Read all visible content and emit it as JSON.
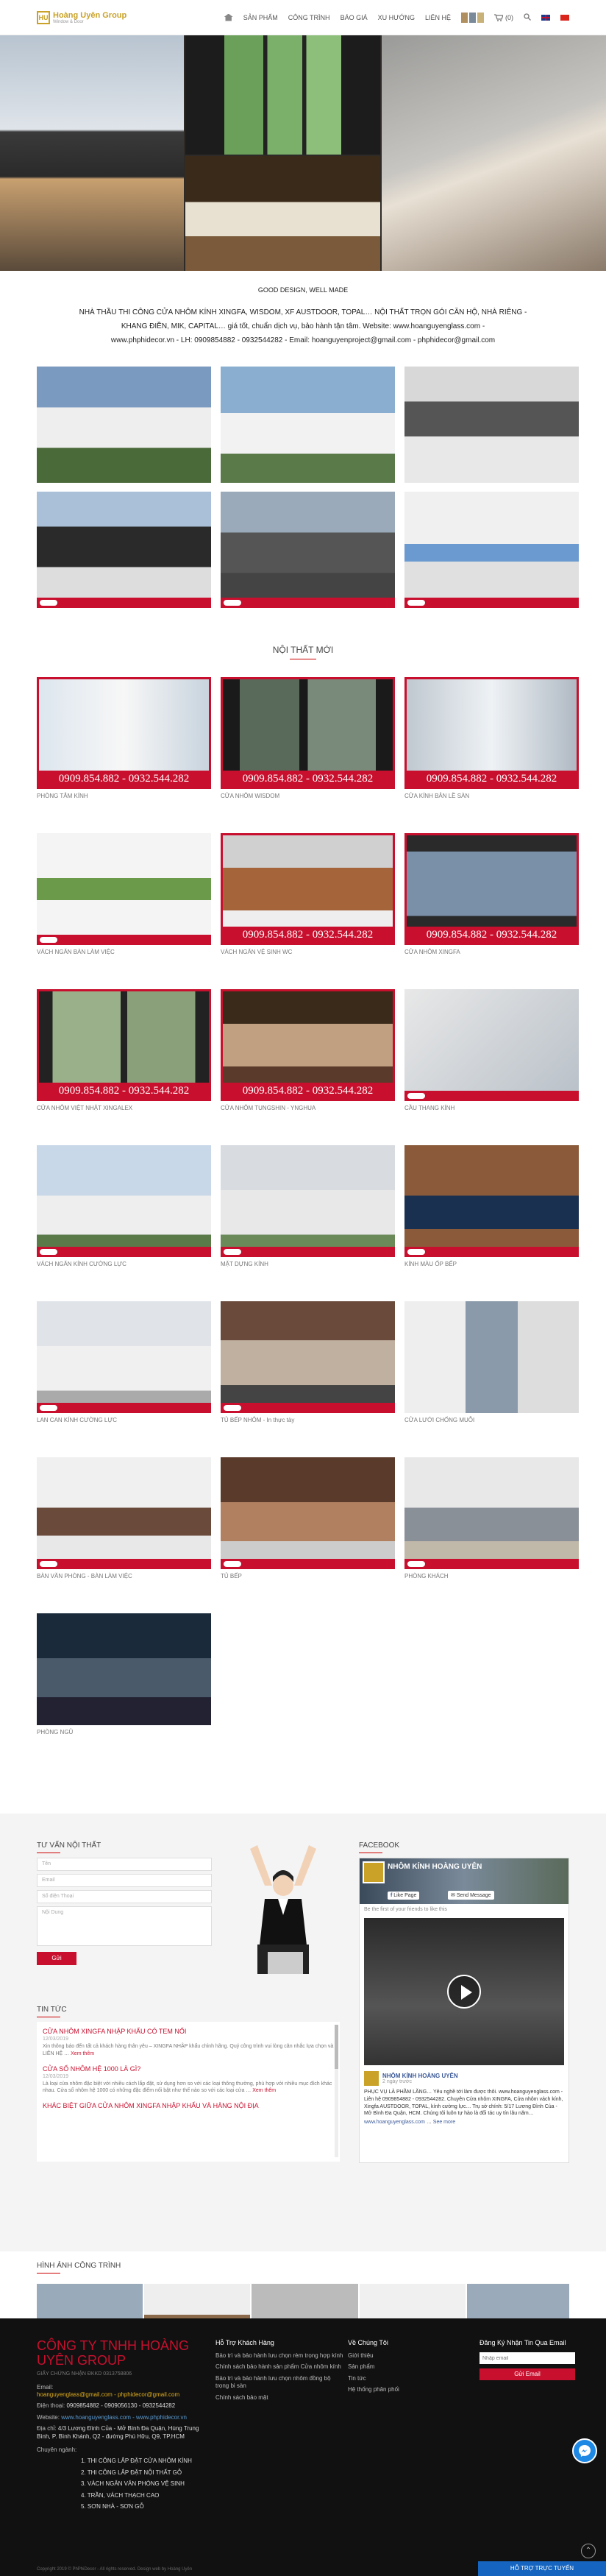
{
  "header": {
    "logo_mark": "HU",
    "logo_title": "Hoàng Uyên Group",
    "logo_sub": "Window & Door",
    "nav": [
      "SẢN PHẨM",
      "CÔNG TRÌNH",
      "BÁO GIÁ",
      "XU HƯỚNG",
      "LIÊN HỆ"
    ],
    "cart": "(0)"
  },
  "intro": {
    "slogan": "GOOD DESIGN, WELL MADE",
    "line1": "NHÀ THẦU THI CÔNG CỬA NHÔM KÍNH XINGFA, WISDOM, XF AUSTDOOR, TOPAL… NỘI THẤT TRỌN GÓI CĂN HỘ, NHÀ RIÊNG -",
    "line2": "KHANG ĐIỀN, MIK, CAPITAL… giá tốt, chuẩn dịch vụ, bảo hành tận tâm. Website: www.hoanguyenglass.com -",
    "line3": "www.phphidecor.vn - LH: 0909854882 - 0932544282 - Email: hoanguyenproject@gmail.com - phphidecor@gmail.com"
  },
  "products": {
    "title": "NỘI THẤT MỚI",
    "phone": "0909.854.882 - 0932.544.282",
    "items": [
      {
        "name": "PHÒNG TẮM KÍNH"
      },
      {
        "name": "CỬA NHÔM WISDOM"
      },
      {
        "name": "CỬA KÍNH BẢN LỀ SÀN"
      },
      {
        "name": "VÁCH NGĂN BÀN LÀM VIỆC"
      },
      {
        "name": "VÁCH NGĂN VỆ SINH WC"
      },
      {
        "name": "CỬA NHÔM XINGFA"
      },
      {
        "name": "CỬA NHÔM VIỆT NHẬT XINGALEX"
      },
      {
        "name": "CỬA NHÔM TUNGSHIN - YNGHUA"
      },
      {
        "name": "CẦU THANG KÍNH"
      },
      {
        "name": "VÁCH NGĂN KÍNH CƯỜNG LỰC"
      },
      {
        "name": "MẶT DỰNG KÍNH"
      },
      {
        "name": "KÍNH MÀU ỐP BẾP"
      },
      {
        "name": "LAN CAN KÍNH CƯỜNG LỰC"
      },
      {
        "name": "TỦ BẾP NHÔM - In thực tày"
      },
      {
        "name": "CỬA LƯỚI CHỐNG MUỖI"
      },
      {
        "name": "BÀN VĂN PHÒNG - BÀN LÀM VIỆC"
      },
      {
        "name": "TỦ BẾP"
      },
      {
        "name": "PHÒNG KHÁCH"
      },
      {
        "name": "PHÒNG NGỦ"
      }
    ]
  },
  "consult": {
    "title": "TƯ VẤN NỘI THẤT",
    "fields": [
      "Tên",
      "Email",
      "Số điện Thoại",
      "Nội Dung"
    ],
    "submit": "Gửi"
  },
  "news": {
    "title": "TIN TỨC",
    "items": [
      {
        "title": "CỬA NHÔM XINGFA NHẬP KHẨU CÓ TEM NỔI",
        "date": "12/03/2019",
        "excerpt": "Xin thông báo đến tất cả khách hàng thân yêu – XINGFA NHẬP khẩu chỉnh hãng. Quý công trình vui lòng cân nhắc lựa chọn và LIÊN HỆ …",
        "more": "Xem thêm"
      },
      {
        "title": "CỬA SỔ NHÔM HỆ 1000 LÀ GÌ?",
        "date": "12/03/2019",
        "excerpt": "Là loại cửa nhôm đặc biệt với nhiều cách lắp đặt, sử dụng hơn so với các loại thông thường, phù hợp với nhiều mục đích khác nhau. Cửa sổ nhôm hệ 1000 có những đặc điểm nổi bật như thế nào so với các loại cửa …",
        "more": "Xem thêm"
      },
      {
        "title": "KHÁC BIỆT GIỮA CỬA NHÔM XINGFA NHẬP KHẨU VÀ HÀNG NỘI ĐỊA",
        "date": "",
        "excerpt": "",
        "more": ""
      }
    ]
  },
  "facebook": {
    "title": "FACEBOOK",
    "page": "NHÔM KÍNH HOÀNG UYÊN",
    "like": "Like Page",
    "msg": "Send Message",
    "first": "Be the first of your friends to like this",
    "post_author": "NHÔM KÍNH HOÀNG UYÊN",
    "post_time": "2 ngày trước",
    "post_text": "PHỤC VỤ LÀ PHẦM LĂNG… Yêu nghề tới làm được thôi. www.hoanguyenglass.com - Liên hệ 0909854882 - 0932544282. Chuyên Cửa nhôm XINGFA, Cửa nhôm vách kính, Xingfa AUSTDOOR, TOPAL, kính cường lực… Trụ sở chính: 5/17 Lương Đình Của - Mở Bình Đa Quận, HCM. Chúng tôi luôn tự hào là đối tác uy tín lâu năm…",
    "post_link": "www.hoanguyenglass.com",
    "see_more": "See more"
  },
  "projects": {
    "title": "HÌNH ẢNH CÔNG TRÌNH"
  },
  "footer": {
    "company": "CÔNG TY TNHH HOÀNG UYÊN GROUP",
    "slogan": "GIẤY CHỨNG NHẬN ĐKKD 0313758806",
    "email_label": "Email:",
    "email": "hoanguyenglass@gmail.com - phphidecor@gmail.com",
    "phone_label": "Điện thoại:",
    "phone": "0909854882 - 0909056130 - 0932544282",
    "web_label": "Website:",
    "web": "www.hoanguyenglass.com - www.phphidecor.vn",
    "addr_label": "Địa chỉ:",
    "addr": "4/3 Lương Đình Của - Mở Bình Đa Quận, Hùng Trung Bình, P. Bình Khánh, Q2 - đường Phú Hữu, Q9, TP.HCM",
    "specialty_label": "Chuyên ngành:",
    "specialties": [
      "1. THI CÔNG LẮP ĐẶT CỬA NHÔM KÍNH",
      "2. THI CÔNG LẮP ĐẶT NỘI THẤT GỖ",
      "3. VÁCH NGĂN VĂN PHÒNG VỆ SINH",
      "4. TRẦN, VÁCH THẠCH CAO",
      "5. SƠN NHÀ - SƠN GỖ"
    ],
    "col2_title": "Hỗ Trợ Khách Hàng",
    "col2": [
      "Bảo trì và bảo hành lưu chọn rèm trọng hợp kính",
      "Chính sách bảo hành sản phẩm Cửa nhôm kính",
      "Bảo trì và bảo hành lưu chọn nhôm đồng bộ trọng bi sàn",
      "Chính sách bảo mật"
    ],
    "col3_title": "Về Chúng Tôi",
    "col3": [
      "Giới thiệu",
      "Sản phẩm",
      "Tin tức",
      "Hệ thống phân phối"
    ],
    "col4_title": "Đăng Ký Nhận Tin Qua Email",
    "newsletter_placeholder": "Nhập email",
    "newsletter_btn": "Gửi Email",
    "copyright": "Copyright 2019 © PhPhiDecor - All rights reserved. Design web by Hoàng Uyên",
    "support": "HỖ TRỢ TRỰC TUYẾN"
  }
}
